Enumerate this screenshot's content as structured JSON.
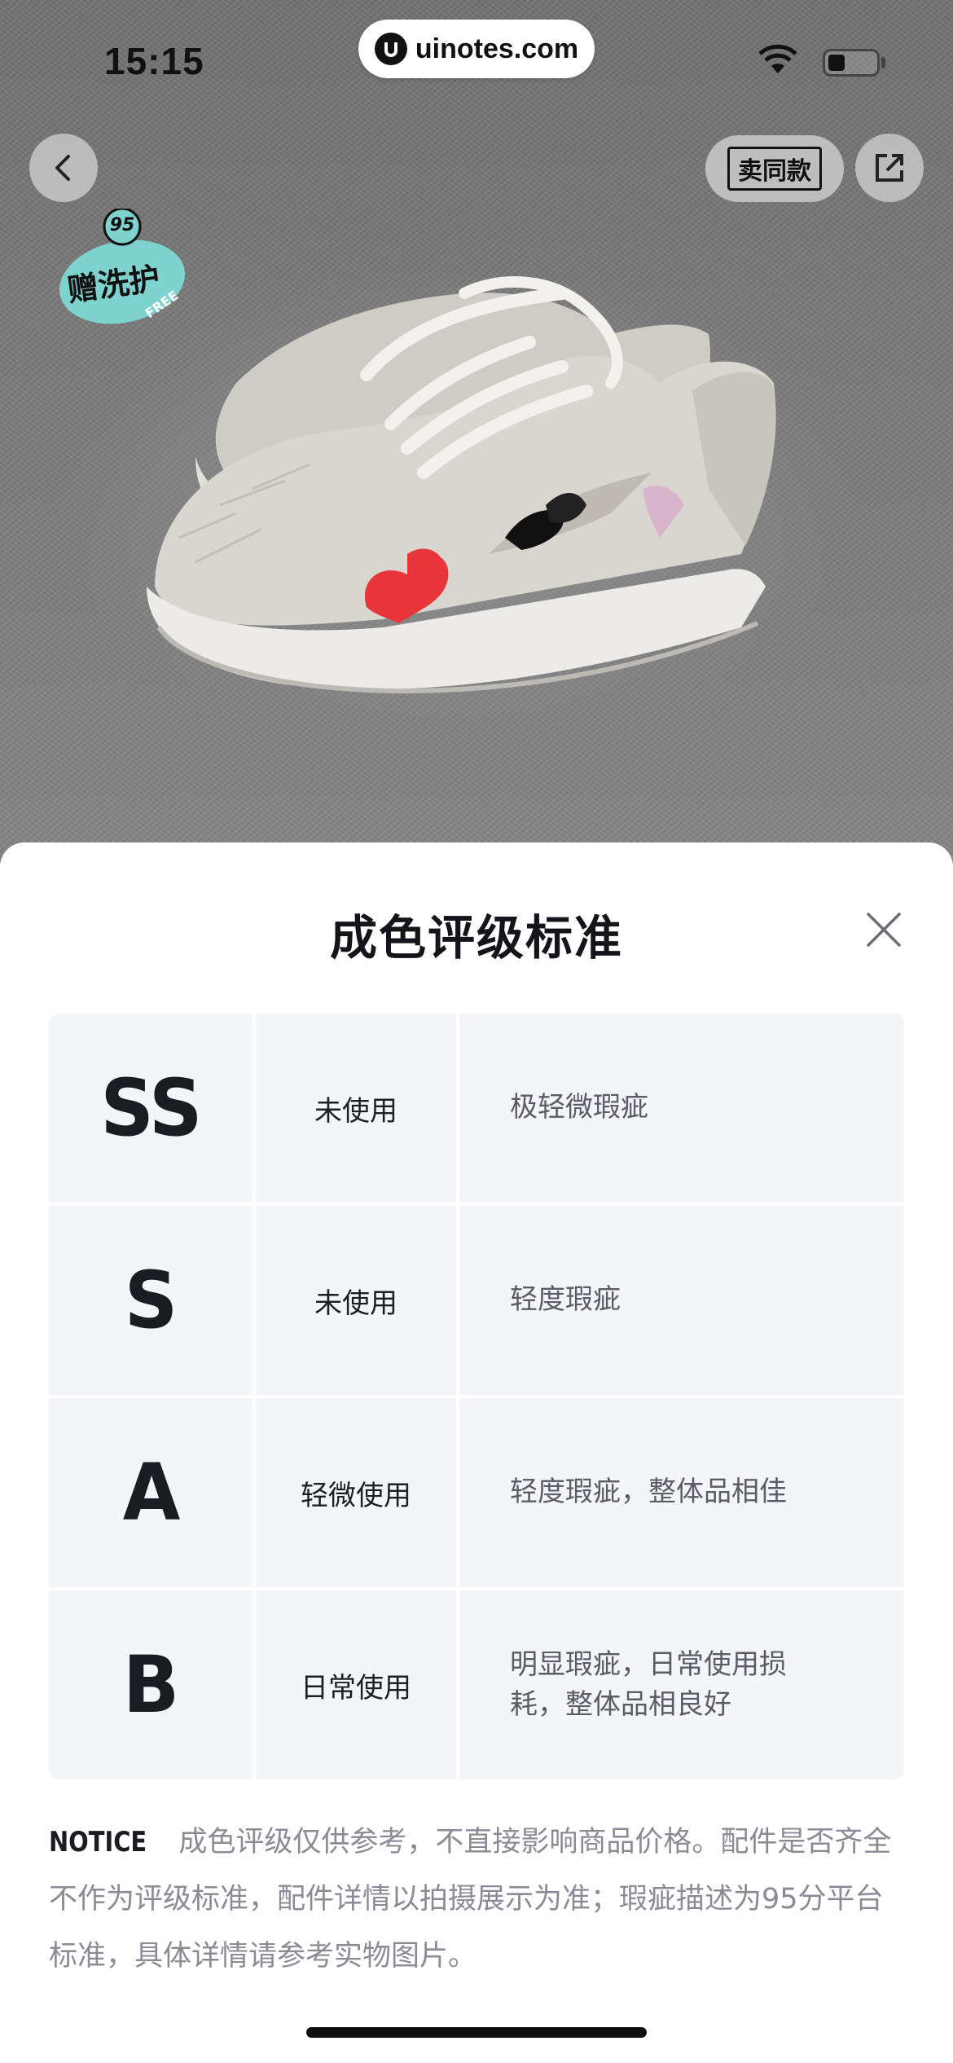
{
  "status_bar": {
    "time": "15:15",
    "url": "uinotes.com",
    "wifi_icon": "wifi-icon",
    "battery_icon": "battery-icon"
  },
  "toolbar": {
    "sell_same_label": "卖同款"
  },
  "badge": {
    "number": "95",
    "text": "赠洗护",
    "sub": "FREE"
  },
  "sheet": {
    "title": "成色评级标准",
    "grades": [
      {
        "grade": "SS",
        "usage": "未使用",
        "description": "极轻微瑕疵"
      },
      {
        "grade": "S",
        "usage": "未使用",
        "description": "轻度瑕疵"
      },
      {
        "grade": "A",
        "usage": "轻微使用",
        "description": "轻度瑕疵，整体品相佳"
      },
      {
        "grade": "B",
        "usage": "日常使用",
        "description": "明显瑕疵，日常使用损耗，整体品相良好"
      }
    ],
    "notice_tag": "NOTICE",
    "notice_text": "成色评级仅供参考，不直接影响商品价格。配件是否齐全不作为评级标准，配件详情以拍摄展示为准；瑕疵描述为95分平台标准，具体详情请参考实物图片。"
  },
  "colors": {
    "accent_badge": "#7fd3cf",
    "heart": "#e8363c",
    "text_primary": "#14151a",
    "text_secondary": "#5b5c66",
    "table_bg": "#f4f5f9"
  }
}
